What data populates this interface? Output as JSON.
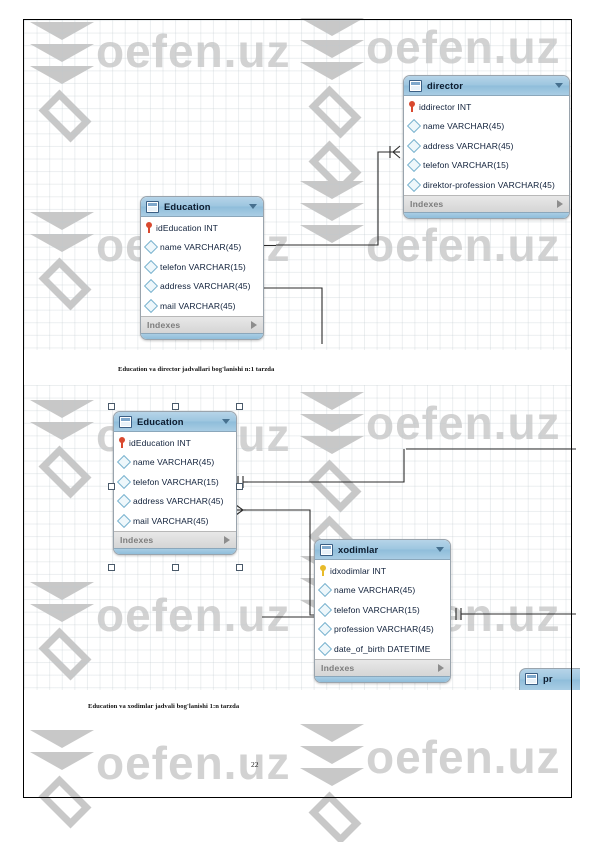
{
  "document": {
    "page_number": "22",
    "watermark_text": "oefen.uz"
  },
  "diagram_1": {
    "caption": "Education va director jadvallari bog'lanishi n:1 tarzda",
    "relationship": "n:1",
    "tables": [
      {
        "name": "director",
        "icon": "table-icon",
        "menu_icon": "chevron-down-icon",
        "footer_label": "Indexes",
        "footer_icon": "expand-arrow-icon",
        "columns": [
          {
            "label": "iddirector INT",
            "key": "primary",
            "icon": "key-icon-red"
          },
          {
            "label": "name VARCHAR(45)",
            "key": "none",
            "icon": "column-diamond-icon"
          },
          {
            "label": "address VARCHAR(45)",
            "key": "none",
            "icon": "column-diamond-icon"
          },
          {
            "label": "telefon VARCHAR(15)",
            "key": "none",
            "icon": "column-diamond-icon"
          },
          {
            "label": "direktor-profession VARCHAR(45)",
            "key": "none",
            "icon": "column-diamond-icon"
          }
        ]
      },
      {
        "name": "Education",
        "icon": "table-icon",
        "menu_icon": "chevron-down-icon",
        "footer_label": "Indexes",
        "footer_icon": "expand-arrow-icon",
        "columns": [
          {
            "label": "idEducation INT",
            "key": "primary",
            "icon": "key-icon-red"
          },
          {
            "label": "name VARCHAR(45)",
            "key": "none",
            "icon": "column-diamond-icon"
          },
          {
            "label": "telefon VARCHAR(15)",
            "key": "none",
            "icon": "column-diamond-icon"
          },
          {
            "label": "address VARCHAR(45)",
            "key": "none",
            "icon": "column-diamond-icon"
          },
          {
            "label": "mail VARCHAR(45)",
            "key": "none",
            "icon": "column-diamond-icon"
          }
        ]
      }
    ]
  },
  "diagram_2": {
    "caption": "Education va xodimlar jadvali bog'lanishi 1:n tarzda",
    "relationship": "1:n",
    "tables": [
      {
        "name": "Education",
        "selected": true,
        "icon": "table-icon",
        "menu_icon": "chevron-down-icon",
        "footer_label": "Indexes",
        "footer_icon": "expand-arrow-icon",
        "columns": [
          {
            "label": "idEducation INT",
            "key": "primary",
            "icon": "key-icon-red"
          },
          {
            "label": "name VARCHAR(45)",
            "key": "none",
            "icon": "column-diamond-icon"
          },
          {
            "label": "telefon VARCHAR(15)",
            "key": "none",
            "icon": "column-diamond-icon"
          },
          {
            "label": "address VARCHAR(45)",
            "key": "none",
            "icon": "column-diamond-icon"
          },
          {
            "label": "mail VARCHAR(45)",
            "key": "none",
            "icon": "column-diamond-icon"
          }
        ]
      },
      {
        "name": "xodimlar",
        "icon": "table-icon",
        "menu_icon": "chevron-down-icon",
        "footer_label": "Indexes",
        "footer_icon": "expand-arrow-icon",
        "columns": [
          {
            "label": "idxodimlar INT",
            "key": "primary",
            "icon": "key-icon-gold"
          },
          {
            "label": "name VARCHAR(45)",
            "key": "none",
            "icon": "column-diamond-icon"
          },
          {
            "label": "telefon VARCHAR(15)",
            "key": "none",
            "icon": "column-diamond-icon"
          },
          {
            "label": "profession VARCHAR(45)",
            "key": "none",
            "icon": "column-diamond-icon"
          },
          {
            "label": "date_of_birth DATETIME",
            "key": "none",
            "icon": "column-diamond-icon"
          }
        ]
      },
      {
        "name": "pr",
        "partial": true,
        "icon": "table-icon"
      }
    ]
  },
  "colors": {
    "table_header_from": "#b6d4e8",
    "table_header_to": "#8fbdda",
    "table_border": "#9aa4ad",
    "key_primary": "#d9492f",
    "key_gold": "#e8bb2a",
    "column_icon": "#7ab3cf",
    "connector": "#2b2b2b",
    "grid": "#bec8cd",
    "watermark": "#d2d2d2"
  }
}
